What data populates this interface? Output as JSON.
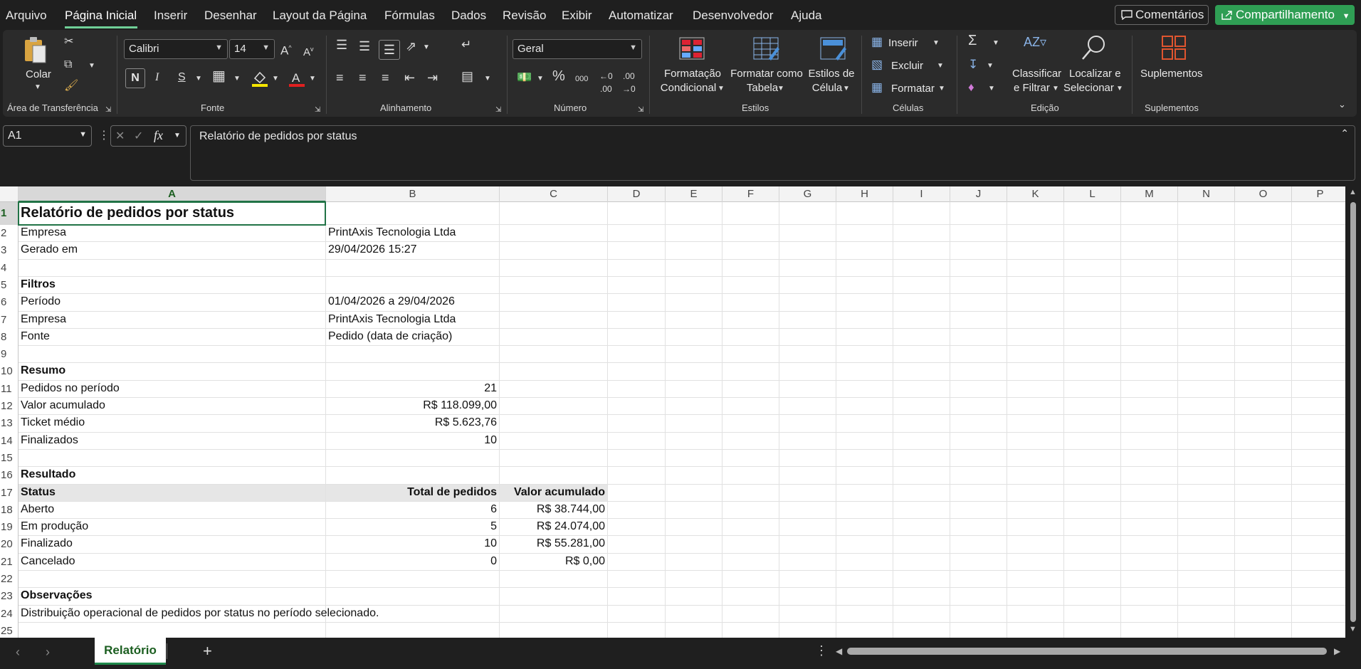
{
  "menu": {
    "items": [
      "Arquivo",
      "Página Inicial",
      "Inserir",
      "Desenhar",
      "Layout da Página",
      "Fórmulas",
      "Dados",
      "Revisão",
      "Exibir",
      "Automatizar",
      "Desenvolvedor",
      "Ajuda"
    ],
    "active": "Página Inicial",
    "comments_label": "Comentários",
    "share_label": "Compartilhamento"
  },
  "ribbon": {
    "clipboard": {
      "paste_label": "Colar",
      "group_label": "Área de Transferência"
    },
    "font": {
      "name": "Calibri",
      "size": "14",
      "group_label": "Fonte",
      "bold": "N",
      "italic": "I",
      "strike": "S"
    },
    "alignment": {
      "group_label": "Alinhamento"
    },
    "number": {
      "format": "Geral",
      "group_label": "Número"
    },
    "styles": {
      "conditional_l1": "Formatação",
      "conditional_l2": "Condicional",
      "table_l1": "Formatar como",
      "table_l2": "Tabela",
      "cell_l1": "Estilos de",
      "cell_l2": "Célula",
      "group_label": "Estilos"
    },
    "cells": {
      "insert": "Inserir",
      "delete": "Excluir",
      "format": "Formatar",
      "group_label": "Células"
    },
    "editing": {
      "sort_l1": "Classificar",
      "sort_l2": "e Filtrar",
      "find_l1": "Localizar e",
      "find_l2": "Selecionar",
      "group_label": "Edição"
    },
    "addins": {
      "label": "Suplementos",
      "group_label": "Suplementos"
    }
  },
  "formula_bar": {
    "name_box": "A1",
    "content": "Relatório de pedidos por status"
  },
  "columns": [
    "A",
    "B",
    "C",
    "D",
    "E",
    "F",
    "G",
    "H",
    "I",
    "J",
    "K",
    "L",
    "M",
    "N",
    "O",
    "P"
  ],
  "rows": [
    "1",
    "2",
    "3",
    "4",
    "5",
    "6",
    "7",
    "8",
    "9",
    "10",
    "11",
    "12",
    "13",
    "14",
    "15",
    "16",
    "17",
    "18",
    "19",
    "20",
    "21",
    "22",
    "23",
    "24",
    "25"
  ],
  "sheet": {
    "title": "Relatório de pedidos por status",
    "empresa_label": "Empresa",
    "empresa_value": "PrintAxis Tecnologia Ltda",
    "gerado_label": "Gerado em",
    "gerado_value": "29/04/2026 15:27",
    "filtros_heading": "Filtros",
    "periodo_label": "Período",
    "periodo_value": "01/04/2026 a 29/04/2026",
    "empresa2_label": "Empresa",
    "empresa2_value": "PrintAxis Tecnologia Ltda",
    "fonte_label": "Fonte",
    "fonte_value": "Pedido (data de criação)",
    "resumo_heading": "Resumo",
    "pedidos_label": "Pedidos no período",
    "pedidos_value": "21",
    "valor_label": "Valor acumulado",
    "valor_value": "R$ 118.099,00",
    "ticket_label": "Ticket médio",
    "ticket_value": "R$ 5.623,76",
    "finalizados_label": "Finalizados",
    "finalizados_value": "10",
    "resultado_heading": "Resultado",
    "table_headers": [
      "Status",
      "Total de pedidos",
      "Valor acumulado"
    ],
    "table_rows": [
      {
        "status": "Aberto",
        "total": "6",
        "valor": "R$ 38.744,00"
      },
      {
        "status": "Em produção",
        "total": "5",
        "valor": "R$ 24.074,00"
      },
      {
        "status": "Finalizado",
        "total": "10",
        "valor": "R$ 55.281,00"
      },
      {
        "status": "Cancelado",
        "total": "0",
        "valor": "R$ 0,00"
      }
    ],
    "obs_heading": "Observações",
    "obs_text": "Distribuição operacional de pedidos por status no período selecionado."
  },
  "footer": {
    "sheet_tab": "Relatório"
  }
}
